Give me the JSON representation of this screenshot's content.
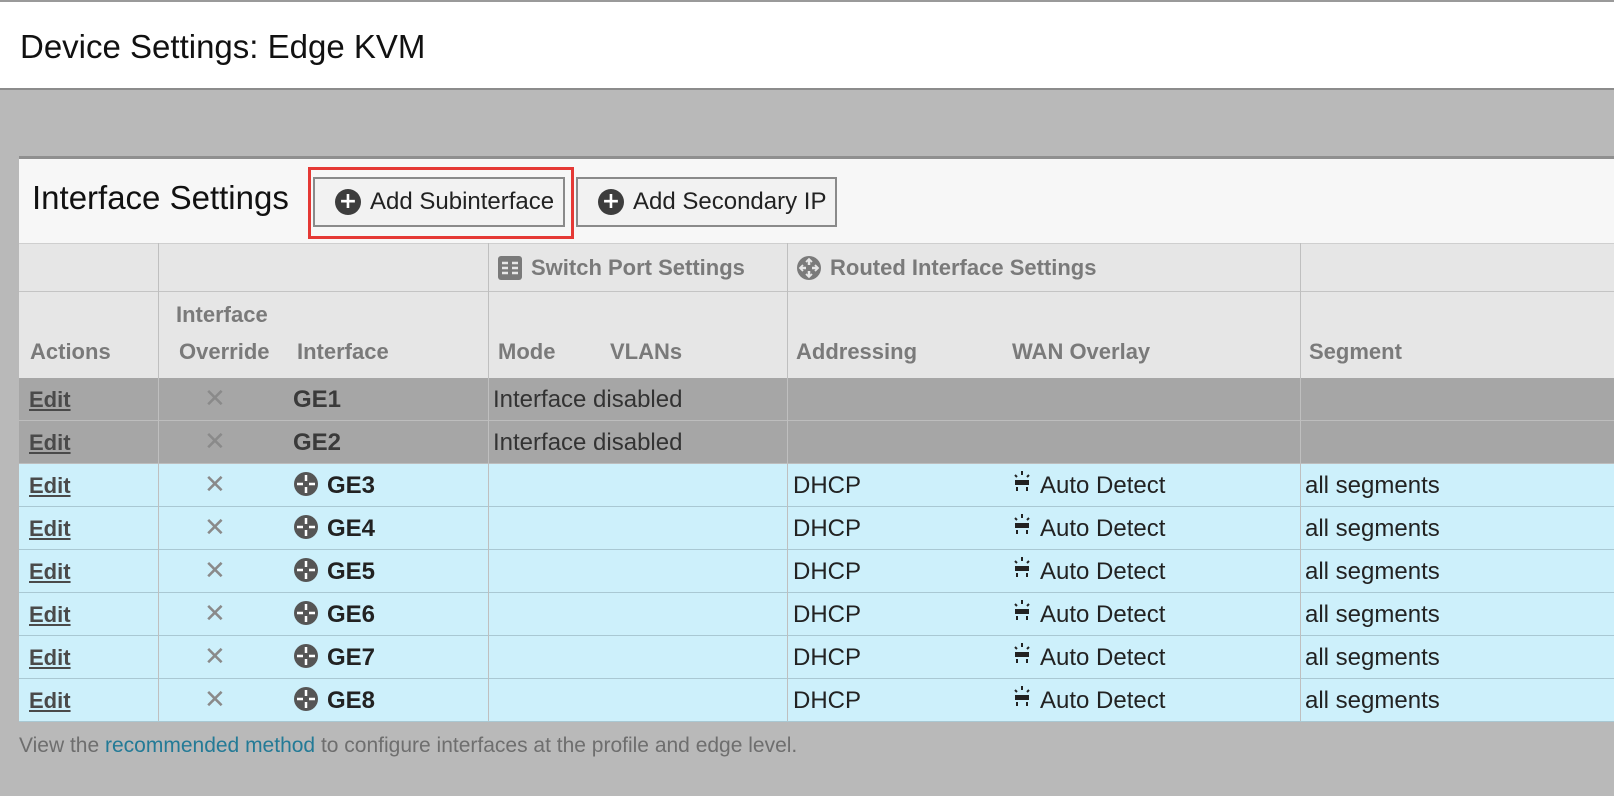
{
  "page": {
    "title": "Device Settings: Edge KVM"
  },
  "panel": {
    "title": "Interface Settings",
    "add_subinterface_label": "Add Subinterface",
    "add_secondary_ip_label": "Add Secondary IP"
  },
  "groups": {
    "switch_port": "Switch Port Settings",
    "routed": "Routed Interface Settings"
  },
  "columns": {
    "actions": "Actions",
    "override_line1": "Interface",
    "override_line2": "Override",
    "interface": "Interface",
    "mode": "Mode",
    "vlans": "VLANs",
    "addressing": "Addressing",
    "wan_overlay": "WAN Overlay",
    "segment": "Segment"
  },
  "rows": [
    {
      "action": "Edit",
      "override": "✕",
      "interface": "GE1",
      "status": "Interface disabled",
      "addressing": "",
      "wan_overlay": "",
      "segment": "",
      "enabled": false
    },
    {
      "action": "Edit",
      "override": "✕",
      "interface": "GE2",
      "status": "Interface disabled",
      "addressing": "",
      "wan_overlay": "",
      "segment": "",
      "enabled": false
    },
    {
      "action": "Edit",
      "override": "✕",
      "interface": "GE3",
      "status": "",
      "addressing": "DHCP",
      "wan_overlay": "Auto Detect",
      "segment": "all segments",
      "enabled": true
    },
    {
      "action": "Edit",
      "override": "✕",
      "interface": "GE4",
      "status": "",
      "addressing": "DHCP",
      "wan_overlay": "Auto Detect",
      "segment": "all segments",
      "enabled": true
    },
    {
      "action": "Edit",
      "override": "✕",
      "interface": "GE5",
      "status": "",
      "addressing": "DHCP",
      "wan_overlay": "Auto Detect",
      "segment": "all segments",
      "enabled": true
    },
    {
      "action": "Edit",
      "override": "✕",
      "interface": "GE6",
      "status": "",
      "addressing": "DHCP",
      "wan_overlay": "Auto Detect",
      "segment": "all segments",
      "enabled": true
    },
    {
      "action": "Edit",
      "override": "✕",
      "interface": "GE7",
      "status": "",
      "addressing": "DHCP",
      "wan_overlay": "Auto Detect",
      "segment": "all segments",
      "enabled": true
    },
    {
      "action": "Edit",
      "override": "✕",
      "interface": "GE8",
      "status": "",
      "addressing": "DHCP",
      "wan_overlay": "Auto Detect",
      "segment": "all segments",
      "enabled": true
    }
  ],
  "footer": {
    "prefix": "View the ",
    "link": "recommended method",
    "suffix": " to configure interfaces at the profile and edge level."
  },
  "icons": {
    "add": "plus-circle-icon",
    "switch_port": "switch-port-icon",
    "routed": "routed-interface-icon",
    "override": "x-mark-icon",
    "wan": "auto-detect-icon"
  },
  "colors": {
    "enabled_row": "#cdf0fb",
    "disabled_row": "#a6a6a6",
    "highlight": "#e53935",
    "link": "#237a96"
  }
}
